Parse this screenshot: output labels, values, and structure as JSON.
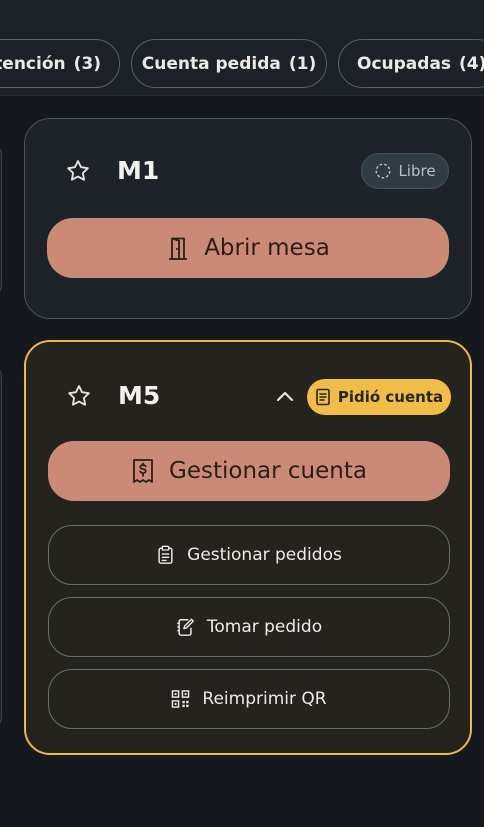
{
  "filters": [
    {
      "label": "atención",
      "count": "(3)"
    },
    {
      "label": "Cuenta pedida",
      "count": "(1)"
    },
    {
      "label": "Ocupadas",
      "count": "(4)"
    }
  ],
  "tables": [
    {
      "name": "M1",
      "status_label": "Libre",
      "primary_action": "Abrir mesa"
    },
    {
      "name": "M5",
      "status_label": "Pidió cuenta",
      "primary_action": "Gestionar cuenta",
      "secondary_actions": [
        "Gestionar pedidos",
        "Tomar pedido",
        "Reimprimir QR"
      ]
    }
  ],
  "icons": {
    "favorite": "star-outline-icon",
    "free": "dashed-circle-icon",
    "open_table": "door-open-icon",
    "bill_requested": "receipt-icon",
    "manage_bill": "receipt-dollar-icon",
    "manage_orders": "clipboard-list-icon",
    "take_order": "notepad-pen-icon",
    "reprint_qr": "qr-code-icon",
    "collapse": "chevron-up-icon"
  },
  "colors": {
    "background": "#15181c",
    "accent_primary": "#cb8a78",
    "bill_requested": "#f0bd4a",
    "card_free_border": "#4a555f"
  }
}
